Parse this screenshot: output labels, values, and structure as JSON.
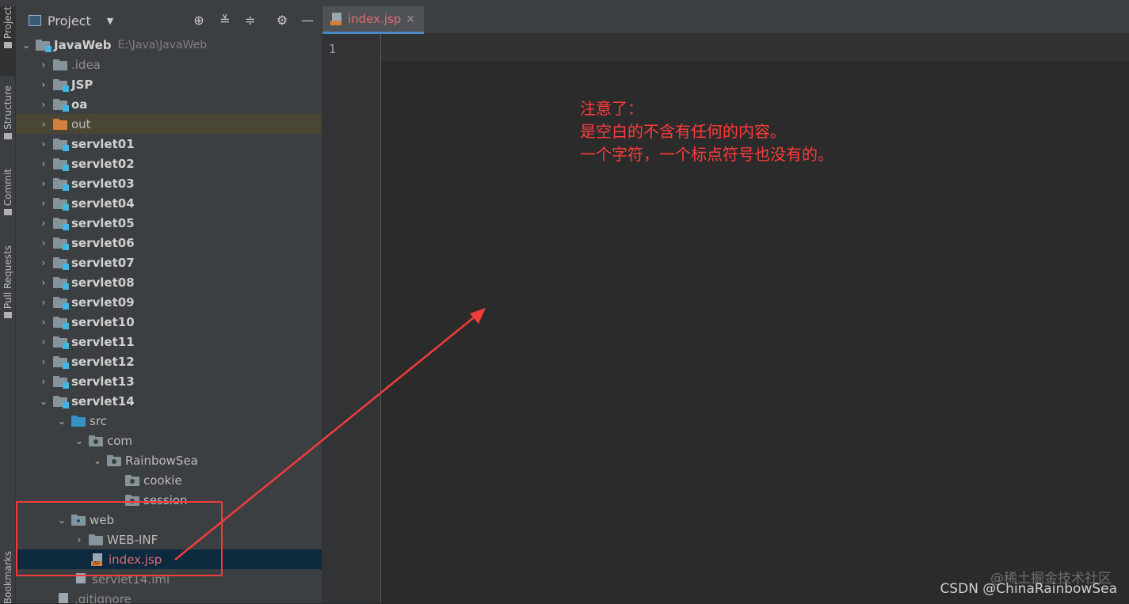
{
  "left_stripe": {
    "tabs": [
      "Project",
      "Structure",
      "Commit",
      "Pull Requests",
      "Bookmarks"
    ]
  },
  "panel": {
    "title": "Project",
    "tree": [
      {
        "label": "JavaWeb",
        "extra": "E:\\Java\\JavaWeb",
        "state": "expanded",
        "icon": "module-folder-icon"
      },
      {
        "label": ".idea",
        "state": "collapsed",
        "icon": "folder-icon"
      },
      {
        "label": "JSP",
        "state": "collapsed",
        "icon": "module-folder-icon"
      },
      {
        "label": "oa",
        "state": "collapsed",
        "icon": "module-folder-icon"
      },
      {
        "label": "out",
        "state": "collapsed",
        "icon": "excluded-folder-icon"
      },
      {
        "label": "servlet01",
        "state": "collapsed",
        "icon": "module-folder-icon"
      },
      {
        "label": "servlet02",
        "state": "collapsed",
        "icon": "module-folder-icon"
      },
      {
        "label": "servlet03",
        "state": "collapsed",
        "icon": "module-folder-icon"
      },
      {
        "label": "servlet04",
        "state": "collapsed",
        "icon": "module-folder-icon"
      },
      {
        "label": "servlet05",
        "state": "collapsed",
        "icon": "module-folder-icon"
      },
      {
        "label": "servlet06",
        "state": "collapsed",
        "icon": "module-folder-icon"
      },
      {
        "label": "servlet07",
        "state": "collapsed",
        "icon": "module-folder-icon"
      },
      {
        "label": "servlet08",
        "state": "collapsed",
        "icon": "module-folder-icon"
      },
      {
        "label": "servlet09",
        "state": "collapsed",
        "icon": "module-folder-icon"
      },
      {
        "label": "servlet10",
        "state": "collapsed",
        "icon": "module-folder-icon"
      },
      {
        "label": "servlet11",
        "state": "collapsed",
        "icon": "module-folder-icon"
      },
      {
        "label": "servlet12",
        "state": "collapsed",
        "icon": "module-folder-icon"
      },
      {
        "label": "servlet13",
        "state": "collapsed",
        "icon": "module-folder-icon"
      },
      {
        "label": "servlet14",
        "state": "expanded",
        "icon": "module-folder-icon"
      },
      {
        "label": "src",
        "state": "expanded",
        "icon": "source-folder-icon"
      },
      {
        "label": "com",
        "state": "expanded",
        "icon": "package-icon"
      },
      {
        "label": "RainbowSea",
        "state": "expanded",
        "icon": "package-icon"
      },
      {
        "label": "cookie",
        "state": "leaf",
        "icon": "package-icon"
      },
      {
        "label": "session",
        "state": "leaf",
        "icon": "package-icon"
      },
      {
        "label": "web",
        "state": "expanded",
        "icon": "web-folder-icon"
      },
      {
        "label": "WEB-INF",
        "state": "collapsed",
        "icon": "folder-icon"
      },
      {
        "label": "index.jsp",
        "state": "leaf",
        "icon": "jsp-file-icon",
        "selected": true
      },
      {
        "label": "servlet14.iml",
        "state": "leaf",
        "icon": "iml-file-icon"
      },
      {
        "label": ".gitignore",
        "state": "leaf",
        "icon": "gitignore-file-icon"
      }
    ]
  },
  "editor": {
    "tab_label": "index.jsp",
    "tab_close": "×",
    "line_number": "1"
  },
  "annotation": {
    "line1": "注意了：",
    "line2": "是空白的不含有任何的内容。",
    "line3": "一个字符，一个标点符号也没有的。",
    "color": "#ff3b3b"
  },
  "watermark": {
    "line1": "@稀土掘金技术社区",
    "line2": "CSDN @ChinaRainbowSea"
  }
}
